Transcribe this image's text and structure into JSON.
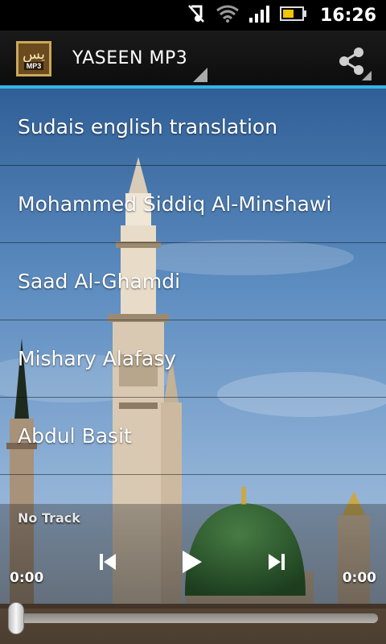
{
  "status_bar": {
    "time": "16:26",
    "icons": [
      "muted-note-icon",
      "wifi-icon",
      "signal-icon",
      "battery-icon"
    ]
  },
  "action_bar": {
    "app_icon_text": "يس",
    "app_icon_badge": "MP3",
    "title": "YASEEN MP3",
    "share_icon": "share-icon",
    "accent_color": "#33b5e5"
  },
  "tracks": [
    {
      "label": "Sudais english translation"
    },
    {
      "label": "Mohammed Siddiq Al-Minshawi"
    },
    {
      "label": "Saad Al-Ghamdi"
    },
    {
      "label": "Mishary Alafasy"
    },
    {
      "label": "Abdul Basit"
    }
  ],
  "player": {
    "now_playing": "No Track",
    "elapsed": "0:00",
    "duration": "0:00",
    "progress": 0,
    "controls": [
      "previous-icon",
      "play-icon",
      "next-icon"
    ]
  }
}
